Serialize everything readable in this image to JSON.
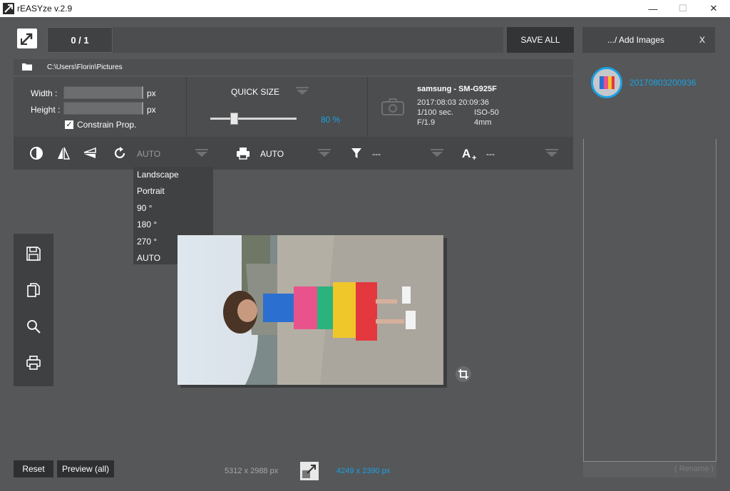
{
  "window": {
    "title": "rEASYze v.2.9",
    "minimize": "—",
    "maximize": "☐",
    "close": "✕"
  },
  "header": {
    "counter": "0 / 1",
    "save_all": "SAVE ALL"
  },
  "path": {
    "folder": "C:\\Users\\Florin\\Pictures"
  },
  "size": {
    "width_label": "Width :",
    "height_label": "Height :",
    "width_value": "",
    "height_value": "",
    "unit": "px",
    "constrain_label": "Constrain Prop.",
    "constrain_checked": true
  },
  "quick_size": {
    "label": "QUICK SIZE",
    "value_text": "80 %",
    "value": 80
  },
  "camera": {
    "model": "samsung - SM-G925F",
    "datetime": "2017:08:03 20:09:36",
    "exposure": "1/100 sec.",
    "iso": "ISO-50",
    "aperture": "F/1.9",
    "focal": "4mm"
  },
  "toolbar": {
    "rotate_value": "AUTO",
    "print_value": "AUTO",
    "filter_value": "---",
    "text_value": "---"
  },
  "rotate_menu": {
    "options": [
      "Landscape",
      "Portrait",
      "90 °",
      "180 °",
      "270 °",
      "AUTO"
    ]
  },
  "footer": {
    "reset": "Reset",
    "preview": "Preview (all)",
    "original_size": "5312 x 2988 px",
    "new_size": "4249 x 2390 px"
  },
  "file_list": {
    "add_images": ".../ Add Images",
    "close": "X",
    "items": [
      {
        "name": "20170803200936"
      }
    ],
    "rename": "( Rename )"
  },
  "colors": {
    "accent": "#1ba1e2",
    "background": "#555759",
    "panel": "#4b4d4f",
    "toolbar": "#444648",
    "dark_button": "#2e2f31"
  }
}
